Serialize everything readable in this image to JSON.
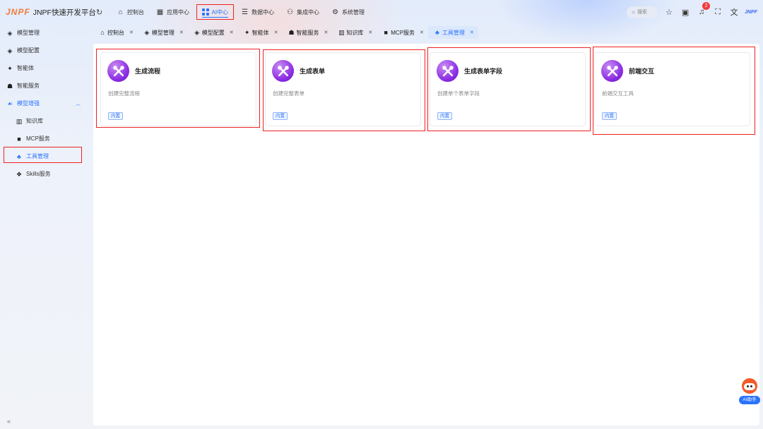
{
  "app": {
    "logo_mark": "JNPF",
    "title": "JNPF快速开发平台"
  },
  "topnav": [
    {
      "label": "控制台",
      "icon": "home-icon"
    },
    {
      "label": "应用中心",
      "icon": "app-icon"
    },
    {
      "label": "AI中心",
      "icon": "grid-icon",
      "active": true
    },
    {
      "label": "数据中心",
      "icon": "database-icon"
    },
    {
      "label": "集成中心",
      "icon": "integration-icon"
    },
    {
      "label": "系统管理",
      "icon": "settings-icon"
    }
  ],
  "header_right": {
    "search_placeholder": "搜索",
    "notification_count": "2",
    "mini_logo": "JNPF"
  },
  "sidebar": {
    "items": [
      {
        "label": "模型管理",
        "icon": "cube-icon"
      },
      {
        "label": "模型配置",
        "icon": "cube-config-icon"
      },
      {
        "label": "智能体",
        "icon": "sparkle-icon"
      },
      {
        "label": "智能服务",
        "icon": "robot-icon"
      },
      {
        "label": "模型增强",
        "icon": "enhance-icon",
        "expanded": true
      },
      {
        "label": "知识库",
        "icon": "library-icon"
      },
      {
        "label": "MCP服务",
        "icon": "server-icon"
      },
      {
        "label": "工具管理",
        "icon": "tools-icon",
        "selected": true
      },
      {
        "label": "Skills服务",
        "icon": "skills-icon"
      }
    ],
    "collapse": "«"
  },
  "tabs": [
    {
      "label": "控制台",
      "icon": "home-icon"
    },
    {
      "label": "模型管理",
      "icon": "cube-icon"
    },
    {
      "label": "模型配置",
      "icon": "cube-config-icon"
    },
    {
      "label": "智能体",
      "icon": "sparkle-icon"
    },
    {
      "label": "智能服务",
      "icon": "robot-icon"
    },
    {
      "label": "知识库",
      "icon": "library-icon"
    },
    {
      "label": "MCP服务",
      "icon": "server-icon"
    },
    {
      "label": "工具管理",
      "icon": "tools-icon",
      "active": true
    }
  ],
  "tools": [
    {
      "title": "生成流程",
      "desc": "创建完整流程",
      "tag": "内置"
    },
    {
      "title": "生成表单",
      "desc": "创建完整表单",
      "tag": "内置"
    },
    {
      "title": "生成表单字段",
      "desc": "创建单个表单字段",
      "tag": "内置"
    },
    {
      "title": "前端交互",
      "desc": "前端交互工具",
      "tag": "内置"
    }
  ],
  "ai_assistant": {
    "label": "AI助手"
  },
  "colors": {
    "accent": "#2b73ff",
    "highlight_box": "#ee2222",
    "tool_icon": "#8a2be2"
  }
}
